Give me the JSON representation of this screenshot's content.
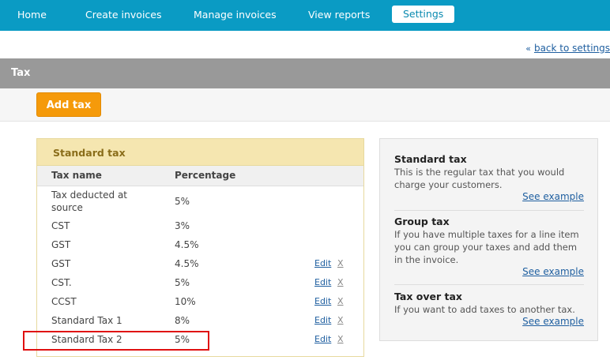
{
  "nav": {
    "items": [
      "Home",
      "Create invoices",
      "Manage invoices",
      "View reports",
      "Settings"
    ],
    "active": "Settings"
  },
  "back_link": {
    "arrow": "«",
    "label": "back to settings"
  },
  "section_title": "Tax",
  "add_tax_label": "Add tax",
  "standard_panel": {
    "title": "Standard tax",
    "columns": [
      "Tax name",
      "Percentage"
    ],
    "rows": [
      {
        "name": "Tax deducted at source",
        "percentage": "5%",
        "edit": "",
        "delete": ""
      },
      {
        "name": "CST",
        "percentage": "3%",
        "edit": "",
        "delete": ""
      },
      {
        "name": "GST",
        "percentage": "4.5%",
        "edit": "",
        "delete": ""
      },
      {
        "name": "GST",
        "percentage": "4.5%",
        "edit": "Edit",
        "delete": "X"
      },
      {
        "name": "CST.",
        "percentage": "5%",
        "edit": "Edit",
        "delete": "X"
      },
      {
        "name": "CCST",
        "percentage": "10%",
        "edit": "Edit",
        "delete": "X"
      },
      {
        "name": "Standard Tax 1",
        "percentage": "8%",
        "edit": "Edit",
        "delete": "X"
      },
      {
        "name": "Standard Tax 2",
        "percentage": "5%",
        "edit": "Edit",
        "delete": "X"
      }
    ]
  },
  "info": {
    "sections": [
      {
        "title": "Standard tax",
        "desc": "This is the regular tax that you would charge your customers.",
        "link": "See example"
      },
      {
        "title": "Group tax",
        "desc": "If you have multiple taxes for a line item you can group your taxes and add them in the invoice.",
        "link": "See example"
      },
      {
        "title": "Tax over tax",
        "desc": "If you want to add taxes to another tax.",
        "link": "See example"
      }
    ]
  },
  "colors": {
    "nav_bg": "#0a9bc4",
    "accent_orange": "#f59a0a",
    "panel_header": "#f5e6b0",
    "highlight": "#e01010"
  }
}
